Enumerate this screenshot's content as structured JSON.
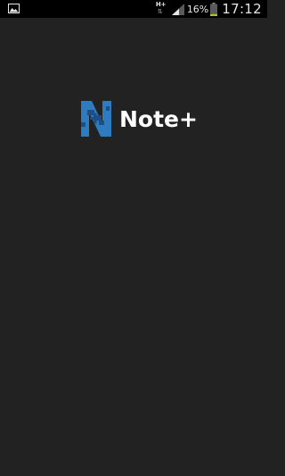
{
  "status_bar": {
    "left_icon": "image-notification-icon",
    "network_type": "H+",
    "network_arrows": "⇅",
    "signal_icon": "signal-bars-icon",
    "battery_percent": "16%",
    "battery_icon": "battery-icon",
    "battery_level": 0.16,
    "battery_color": "#a4c639",
    "time": "17:12"
  },
  "splash": {
    "logo_icon": "note-plus-logo-icon",
    "app_name": "Note+",
    "logo_colors": {
      "primary": "#2f7bbf",
      "dark": "#1d4f86"
    }
  },
  "background_color": "#222222"
}
